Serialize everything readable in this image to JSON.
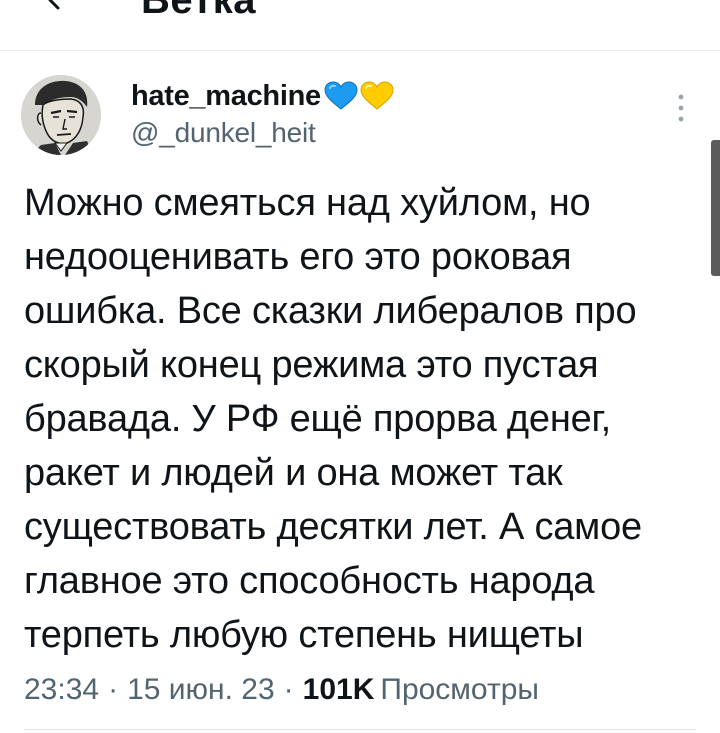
{
  "header": {
    "title": "Ветка"
  },
  "author": {
    "display_name": "hate_machine",
    "handle": "@_dunkel_heit",
    "badges": [
      "blue-heart-icon",
      "yellow-heart-icon"
    ]
  },
  "tweet": {
    "text": "Можно смеяться над хуйлом, но\nнедооценивать его это роковая\nошибка. Все сказки либералов про\nскорый конец режима это пустая\nбравада. У РФ ещё прорва денег,\nракет и людей и она может так\nсуществовать десятки лет. А самое\nглавное это способность народа\nтерпеть любую степень нищеты"
  },
  "meta": {
    "time": "23:34",
    "date": "15 июн. 23",
    "views_count": "101K",
    "views_label": "Просмотры",
    "separator": "·"
  },
  "colors": {
    "text_primary": "#0f1419",
    "text_secondary": "#536471",
    "heart_blue": "#1d9bf0",
    "heart_yellow": "#ffd000"
  }
}
